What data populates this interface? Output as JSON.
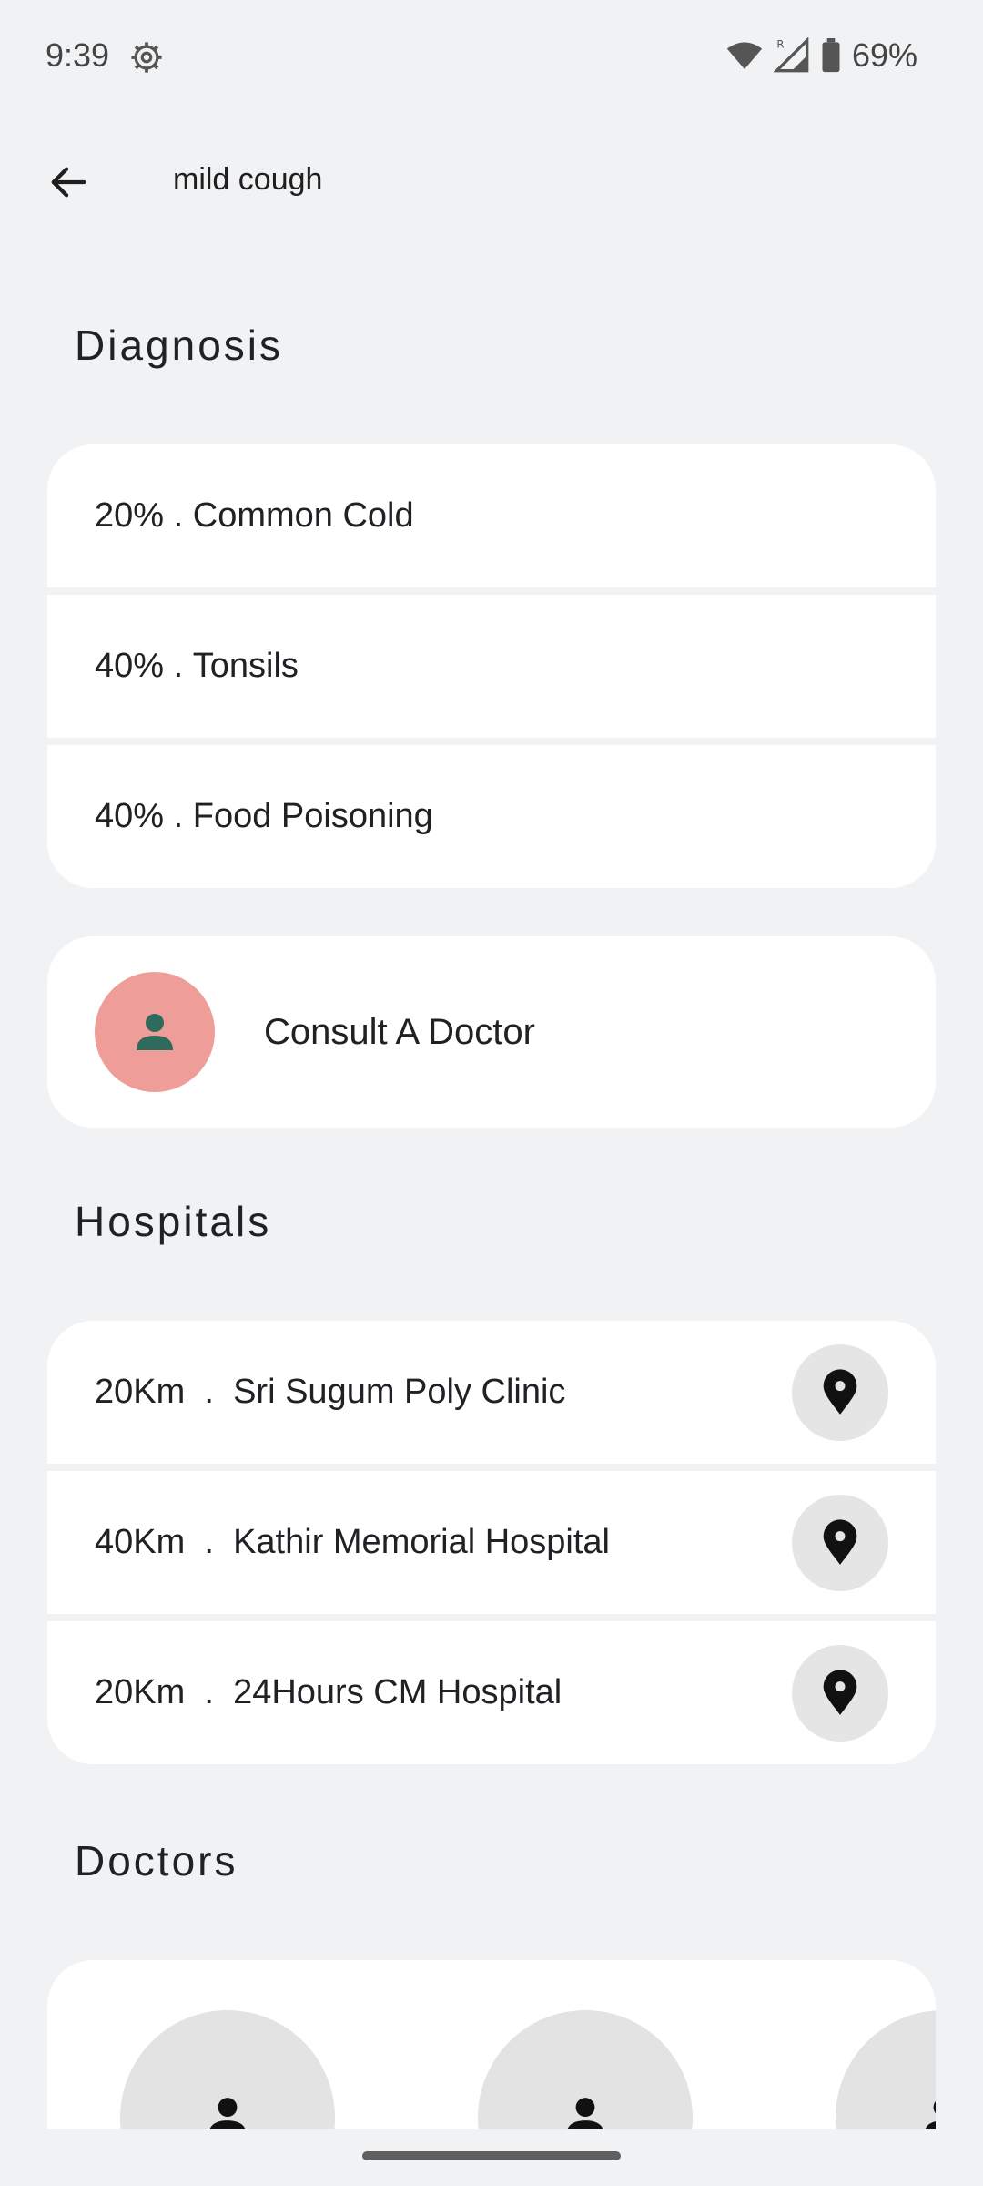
{
  "status_bar": {
    "time": "9:39",
    "battery": "69%",
    "icons": [
      "settings-gear-icon",
      "wifi-icon",
      "signal-icon",
      "battery-icon"
    ]
  },
  "app_bar": {
    "back_icon": "arrow-back-icon",
    "query": "mild cough"
  },
  "diagnosis": {
    "title": "Diagnosis",
    "items": [
      {
        "percent": "20%",
        "name": "Common Cold"
      },
      {
        "percent": "40%",
        "name": "Tonsils"
      },
      {
        "percent": "40%",
        "name": "Food Poisoning"
      }
    ]
  },
  "consult": {
    "label": "Consult A Doctor",
    "icon": "person-icon",
    "avatar_color": "#ee9d99",
    "icon_color": "#2e6b5c"
  },
  "hospitals": {
    "title": "Hospitals",
    "items": [
      {
        "distance": "20Km",
        "name": "Sri Sugum Poly Clinic"
      },
      {
        "distance": "40Km",
        "name": "Kathir Memorial Hospital"
      },
      {
        "distance": "20Km",
        "name": "24Hours CM Hospital"
      }
    ],
    "pin_icon": "location-pin-icon"
  },
  "doctors": {
    "title": "Doctors",
    "avatar_icon": "person-icon"
  }
}
